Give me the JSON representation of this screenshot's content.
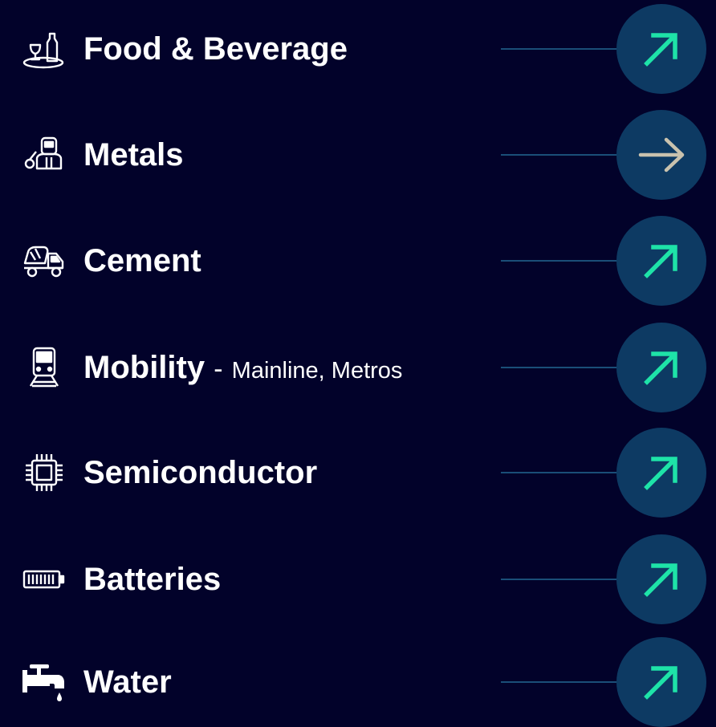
{
  "colors": {
    "background": "#02022a",
    "circle": "#0d3a63",
    "connector": "#1a4e78",
    "accent_arrow": "#1ee3a8",
    "neutral_arrow": "#c9c2ae",
    "text": "#ffffff"
  },
  "items": [
    {
      "icon": "food-beverage-icon",
      "label": "Food & Beverage",
      "arrow": "arrow-up-right-icon"
    },
    {
      "icon": "welder-icon",
      "label": "Metals",
      "arrow": "arrow-right-icon"
    },
    {
      "icon": "cement-mixer-truck-icon",
      "label": "Cement",
      "arrow": "arrow-up-right-icon"
    },
    {
      "icon": "train-icon",
      "label": "Mobility",
      "separator": "-",
      "sublabel": "Mainline, Metros",
      "arrow": "arrow-up-right-icon"
    },
    {
      "icon": "chip-icon",
      "label": "Semiconductor",
      "arrow": "arrow-up-right-icon"
    },
    {
      "icon": "battery-icon",
      "label": "Batteries",
      "arrow": "arrow-up-right-icon"
    },
    {
      "icon": "water-tap-icon",
      "label": "Water",
      "arrow": "arrow-up-right-icon"
    }
  ]
}
